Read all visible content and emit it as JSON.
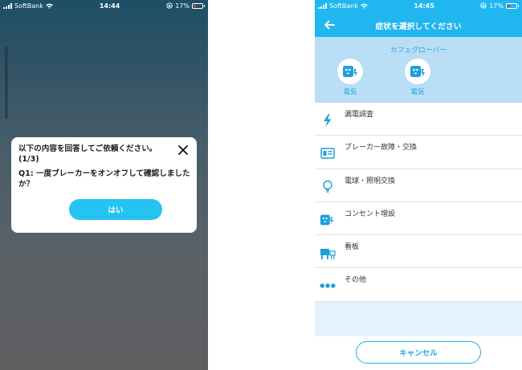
{
  "left": {
    "status": {
      "carrier": "SoftBank",
      "time": "14:44",
      "battery": "17%"
    },
    "dialog": {
      "title": "以下の内容を回答してご依頼ください。(1/3)",
      "question": "Q1: 一度ブレーカーをオンオフして確認しましたか？",
      "yes_label": "はい"
    }
  },
  "right": {
    "status": {
      "carrier": "SoftBank",
      "time": "14:45",
      "battery": "17%"
    },
    "header": {
      "title": "症状を選択してください"
    },
    "category": {
      "name": "カフェグローバー",
      "items": [
        {
          "label": "電気",
          "icon": "outlet-icon"
        },
        {
          "label": "電気",
          "icon": "outlet-icon"
        }
      ]
    },
    "menu": [
      {
        "label": "漏電調査",
        "icon": "lightning-icon"
      },
      {
        "label": "ブレーカー故障・交換",
        "icon": "breaker-icon"
      },
      {
        "label": "電球・照明交換",
        "icon": "bulb-icon"
      },
      {
        "label": "コンセント増設",
        "icon": "outlet-icon"
      },
      {
        "label": "看板",
        "icon": "signboard-icon"
      },
      {
        "label": "その他",
        "icon": "more-icon"
      }
    ],
    "footer": {
      "cancel_label": "キャンセル"
    }
  },
  "colors": {
    "accent": "#20b6f0",
    "category_bg": "#b9def6",
    "icon_blue": "#1e9fd8"
  }
}
